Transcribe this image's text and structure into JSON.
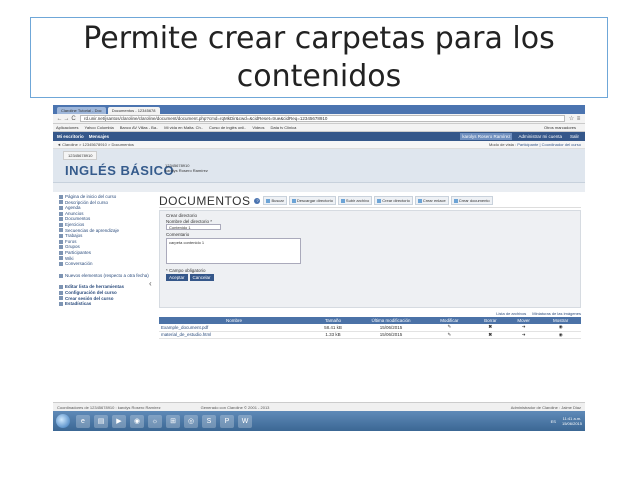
{
  "slide": {
    "title": "Permite crear carpetas para los contenidos"
  },
  "browser": {
    "tabs": [
      "Claroline Tutorial - Doc",
      "Documentos - 12345678"
    ],
    "nav": {
      "back": "←",
      "forward": "→",
      "reload": "C"
    },
    "url": "rd.unir.net/jsantos/claroline/claroline/document/document.php?cmd=rqMkDir&cwd=&cidReset=true&cidReq=12345678910",
    "star": "☆",
    "menu": "≡",
    "bookmarks": [
      "Aplicaciones",
      "Yahoo Colombia",
      "Banco AV Villas - Ba..",
      "Mi vida en Malta. Ch..",
      "Curso de inglés onli..",
      "Videos",
      "Data tv Clinica"
    ],
    "other_bookmarks": "Otros marcadores"
  },
  "topbar": {
    "left": [
      "Mi escritorio",
      "Mensajes"
    ],
    "right": [
      "karolys Rosero Ramírez",
      "Administrar mi cuenta",
      "Salir"
    ]
  },
  "crumbs": {
    "path": "◄ Claroline > 12345678910 > Documentos",
    "view_mode_label": "Modo de vista :",
    "view_mode": "Participante | Coordinador del curso"
  },
  "course": {
    "code_tab": "12345678910",
    "title": "INGLÉS BÁSICO",
    "meta_code": "12345678910",
    "meta_teacher": "karolys Rosero Ramírez"
  },
  "sidebar": {
    "items": [
      "Página de inicio del curso",
      "Descripción del curso",
      "Agenda",
      "Anuncios",
      "Documentos",
      "Ejercicios",
      "Secuencias de aprendizaje",
      "Trabajos",
      "Foros",
      "Grupos",
      "Participantes",
      "Wiki",
      "Conversación"
    ],
    "new_items": "Nuevos elementos (respecto a otra fecha)",
    "tools": [
      "Editar lista de herramientas",
      "Configuración del curso",
      "Crear sesión del curso",
      "Estadísticas"
    ],
    "collapse": "‹"
  },
  "main": {
    "heading": "DOCUMENTOS",
    "help": "?",
    "toolbar": [
      "Buscar",
      "Descargar directorio",
      "Subir archivo",
      "Crear directorio",
      "Crear enlace",
      "Crear documento"
    ],
    "form": {
      "title": "Crear directorio",
      "name_label": "Nombre del directorio *",
      "name_value": "Contenido 1",
      "comment_label": "Comentario",
      "comment_value": "carpeta contenido 1",
      "required_note": "* Campo obligatorio",
      "accept": "Aceptar",
      "cancel": "Cancelar"
    },
    "table_tools": [
      "Lista de archivos",
      "Miniaturas de las imágenes"
    ],
    "table": {
      "headers": [
        "Nombre",
        "Tamaño",
        "Última modificación",
        "Modificar",
        "Borrar",
        "Mover",
        "Mostrar"
      ],
      "rows": [
        {
          "name": "Example_document.pdf",
          "size": "58.41 kB",
          "date": "15/06/2015"
        },
        {
          "name": "material_de_estudio.html",
          "size": "1.33 kB",
          "date": "15/06/2015"
        }
      ]
    }
  },
  "footer": {
    "left": "Coordinadores de 12345678910 : karolys Rosero Ramírez",
    "center": "Generado con Claroline © 2001 - 2013",
    "right": "Administrador de Claroline : Jaime Diaz"
  },
  "taskbar": {
    "apps": [
      "e",
      "▤",
      "▶",
      "◉",
      "☼",
      "⊞",
      "◎",
      "S",
      "P",
      "W"
    ],
    "lang": "ES",
    "time": "11:41 a.m.",
    "date": "15/06/2015"
  }
}
